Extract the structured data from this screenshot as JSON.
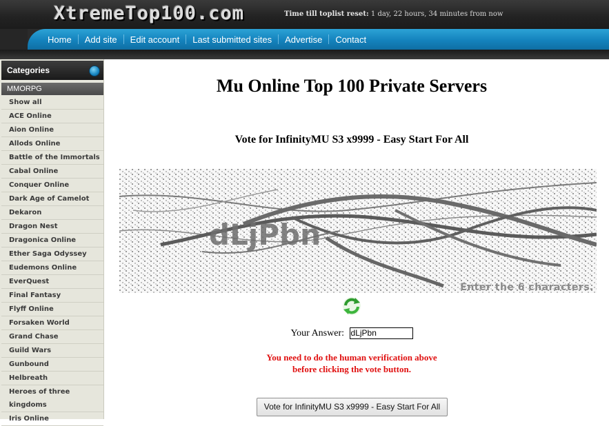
{
  "header": {
    "logo": "XtremeTop100.com",
    "reset_label": "Time till toplist reset:",
    "reset_value": " 1 day, 22 hours, 34 minutes from now"
  },
  "nav": {
    "items": [
      "Home",
      "Add site",
      "Edit account",
      "Last submitted sites",
      "Advertise",
      "Contact"
    ]
  },
  "sidebar": {
    "heading": "Categories",
    "section": "MMORPG",
    "items": [
      "Show all",
      "ACE Online",
      "Aion Online",
      "Allods Online",
      "Battle of the Immortals",
      "Cabal Online",
      "Conquer Online",
      "Dark Age of Camelot",
      "Dekaron",
      "Dragon Nest",
      "Dragonica Online",
      "Ether Saga Odyssey",
      "Eudemons Online",
      "EverQuest",
      "Final Fantasy",
      "Flyff Online",
      "Forsaken World",
      "Grand Chase",
      "Guild Wars",
      "Gunbound",
      "Helbreath",
      "Heroes of three kingdoms",
      "Iris Online"
    ]
  },
  "main": {
    "title": "Mu Online Top 100 Private Servers",
    "vote_title": "Vote for InfinityMU S3 x9999 - Easy Start For All",
    "captcha_hint": "Enter the 6 characters.",
    "answer_label": "Your Answer:",
    "answer_value": "dLjPbn",
    "error_line1": "You need to do the human verification above",
    "error_line2": "before clicking the vote button.",
    "vote_button": "Vote for InfinityMU S3 x9999 - Easy Start For All"
  },
  "colors": {
    "nav_blue": "#1483bd",
    "error_red": "#e01010",
    "sidebar_bg": "#e6e6dc"
  },
  "icons": [
    "refresh-icon",
    "category-orb-icon"
  ]
}
